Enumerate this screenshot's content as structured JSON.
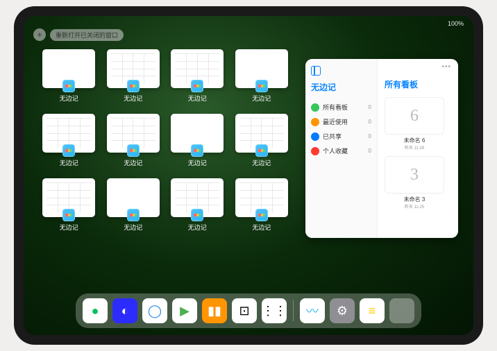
{
  "status": {
    "text": "100%"
  },
  "controls": {
    "plus": "+",
    "reopen": "重新打开已关闭的窗口"
  },
  "app_windows": [
    {
      "label": "无边记",
      "has_content": false
    },
    {
      "label": "无边记",
      "has_content": true
    },
    {
      "label": "无边记",
      "has_content": true
    },
    {
      "label": "无边记",
      "has_content": false
    },
    {
      "label": "无边记",
      "has_content": true
    },
    {
      "label": "无边记",
      "has_content": true
    },
    {
      "label": "无边记",
      "has_content": false
    },
    {
      "label": "无边记",
      "has_content": true
    },
    {
      "label": "无边记",
      "has_content": true
    },
    {
      "label": "无边记",
      "has_content": false
    },
    {
      "label": "无边记",
      "has_content": true
    },
    {
      "label": "无边记",
      "has_content": true
    }
  ],
  "panel": {
    "dots": "•••",
    "left_title": "无边记",
    "right_title": "所有看板",
    "sidebar": [
      {
        "label": "所有看板",
        "count": "0",
        "color": "#34c759"
      },
      {
        "label": "最近使用",
        "count": "0",
        "color": "#ff9500"
      },
      {
        "label": "已共享",
        "count": "0",
        "color": "#007aff"
      },
      {
        "label": "个人收藏",
        "count": "0",
        "color": "#ff3b30"
      }
    ],
    "boards": [
      {
        "glyph": "6",
        "label": "未命名 6",
        "sub": "昨天 11:28"
      },
      {
        "glyph": "3",
        "label": "未命名 3",
        "sub": "昨天 11:25"
      }
    ]
  },
  "dock": [
    {
      "name": "wechat",
      "bg": "#fff",
      "glyph": "●",
      "color": "#07c160"
    },
    {
      "name": "quark",
      "bg": "#2c2cff",
      "glyph": "◐",
      "color": "#fff"
    },
    {
      "name": "qq-browser",
      "bg": "#fff",
      "glyph": "◯",
      "color": "#1e88e5"
    },
    {
      "name": "play",
      "bg": "#fff",
      "glyph": "▶",
      "color": "#4caf50"
    },
    {
      "name": "books",
      "bg": "#ff9500",
      "glyph": "▮▮",
      "color": "#fff"
    },
    {
      "name": "dice",
      "bg": "#fff",
      "glyph": "⊡",
      "color": "#000"
    },
    {
      "name": "nodes",
      "bg": "#fff",
      "glyph": "⋮⋮",
      "color": "#000"
    },
    {
      "name": "freeform",
      "bg": "#fff",
      "glyph": "〰",
      "color": "#29b6f6"
    },
    {
      "name": "settings",
      "bg": "#8e8e93",
      "glyph": "⚙",
      "color": "#fff"
    },
    {
      "name": "notes",
      "bg": "#fff",
      "glyph": "≡",
      "color": "#ffcc00"
    }
  ]
}
